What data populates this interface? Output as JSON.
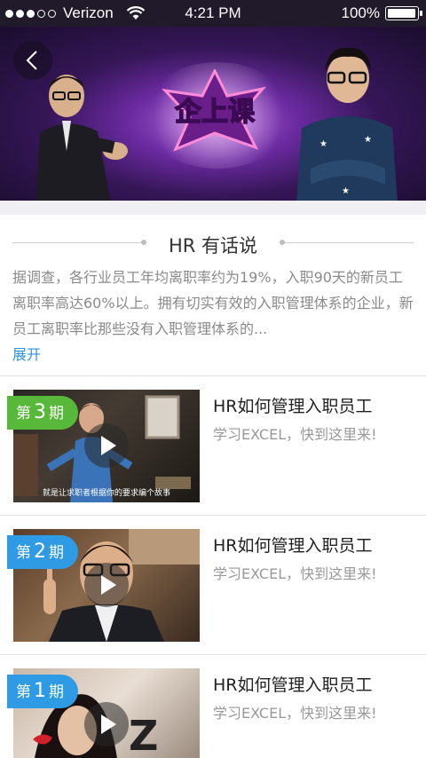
{
  "status_bar": {
    "carrier": "Verizon",
    "time": "4:21 PM",
    "battery": "100%",
    "battery_level": 1.0
  },
  "banner": {
    "logo_text": "企上课",
    "back_icon": "back-chevron-icon"
  },
  "intro": {
    "title": "HR 有话说",
    "text": "据调查，各行业员工年均离职率约为19%，入职90天的新员工离职率高达60%以上。拥有切实有效的入职管理体系的企业，新员工离职率比那些没有入职管理体系的...",
    "expand_label": "展开"
  },
  "episodes": [
    {
      "prefix": "第",
      "number": "3",
      "suffix": "期",
      "title": "HR如何管理入职员工",
      "subtitle": "学习EXCEL，快到这里来!",
      "badge_color": "#58b83a",
      "caption": "就是让求职者根据你的要求编个故事"
    },
    {
      "prefix": "第",
      "number": "2",
      "suffix": "期",
      "title": "HR如何管理入职员工",
      "subtitle": "学习EXCEL，快到这里来!",
      "badge_color": "#2e9be4"
    },
    {
      "prefix": "第",
      "number": "1",
      "suffix": "期",
      "title": "HR如何管理入职员工",
      "subtitle": "学习EXCEL，快到这里来!",
      "badge_color": "#2e9be4"
    }
  ]
}
